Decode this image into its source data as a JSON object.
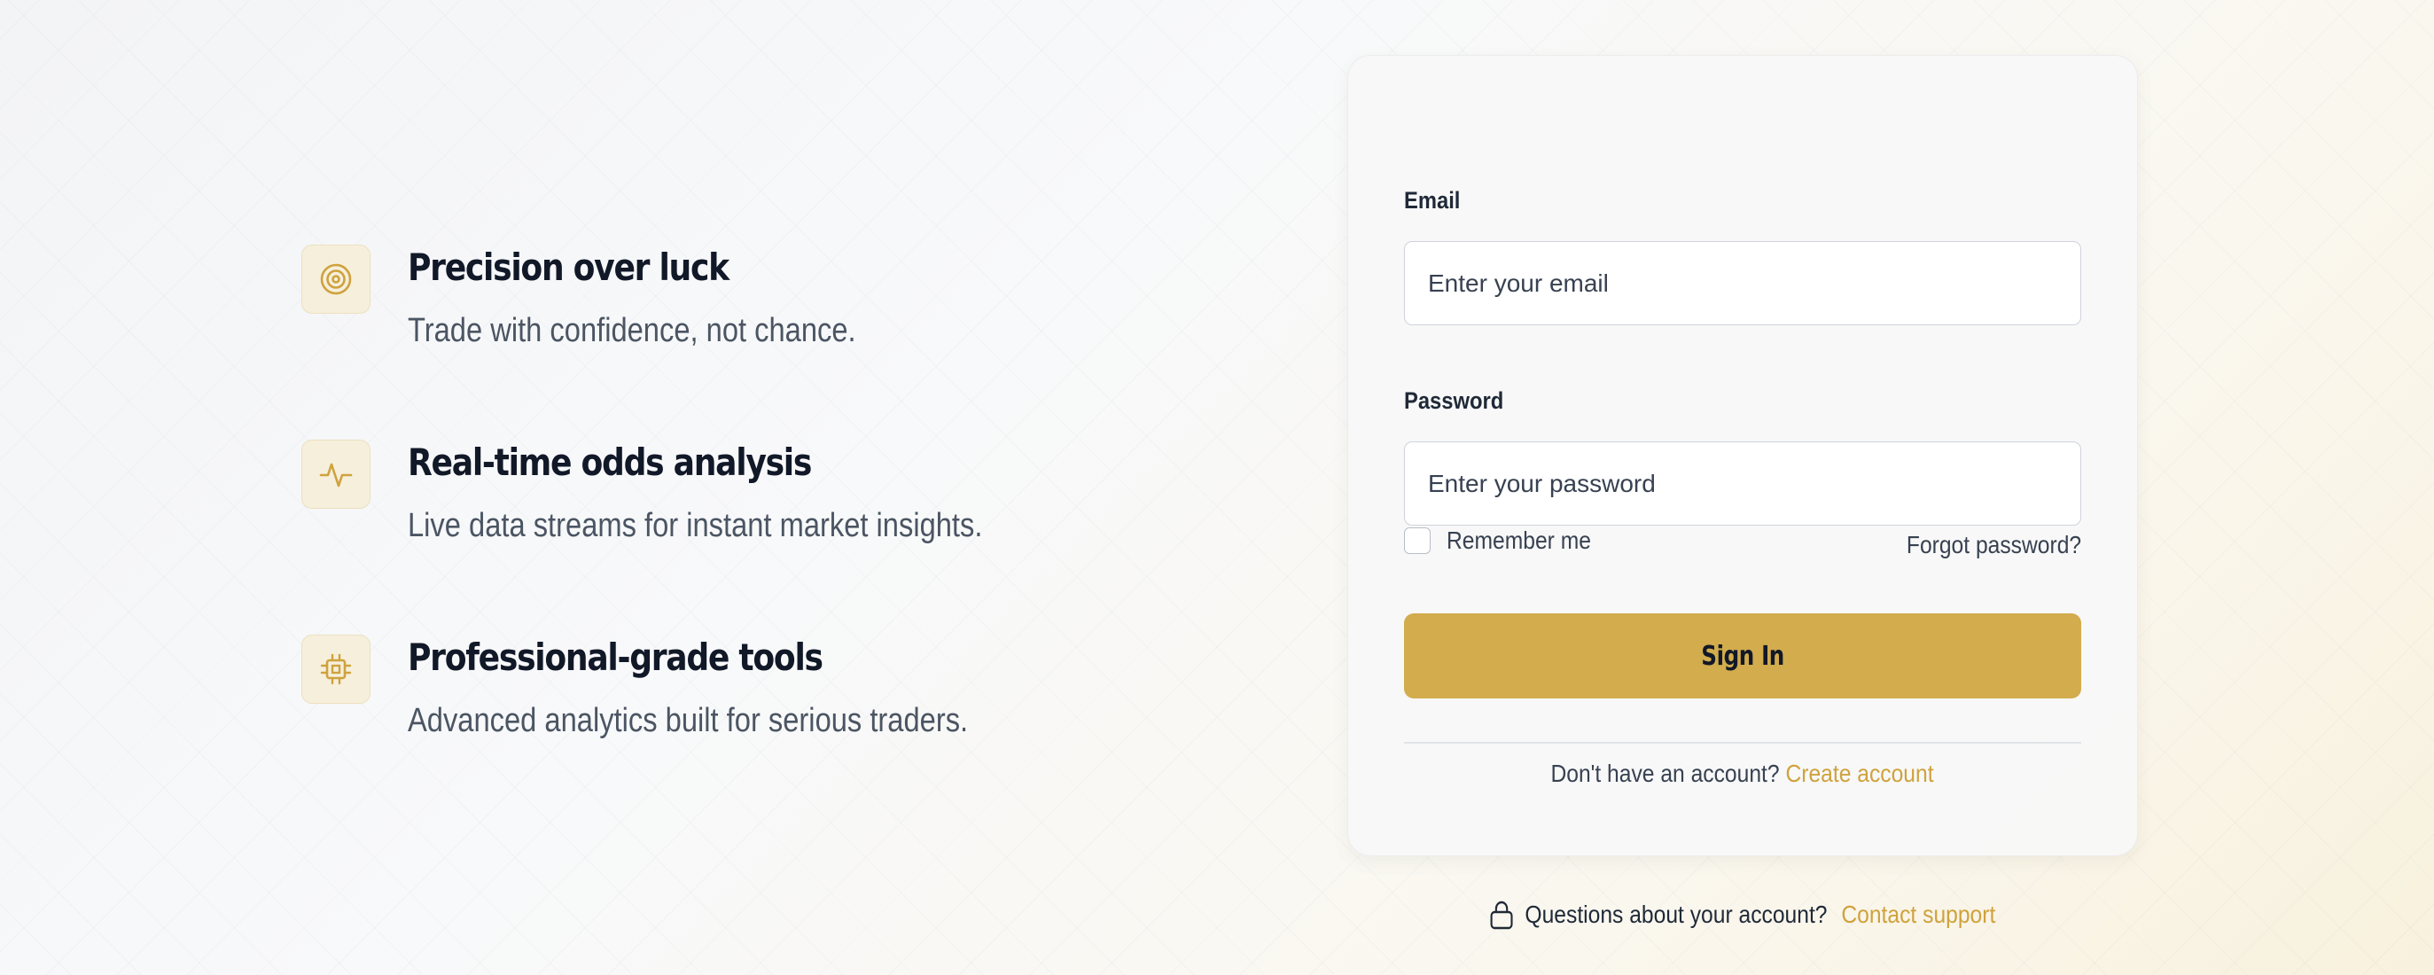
{
  "features": [
    {
      "icon": "target-icon",
      "title": "Precision over luck",
      "description": "Trade with confidence, not chance."
    },
    {
      "icon": "activity-pulse-icon",
      "title": "Real-time odds analysis",
      "description": "Live data streams for instant market insights."
    },
    {
      "icon": "cpu-chip-icon",
      "title": "Professional-grade tools",
      "description": "Advanced analytics built for serious traders."
    }
  ],
  "login": {
    "email_label": "Email",
    "email_placeholder": "Enter your email",
    "email_value": "",
    "password_label": "Password",
    "password_placeholder": "Enter your password",
    "password_value": "",
    "remember_label": "Remember me",
    "remember_checked": false,
    "forgot_label": "Forgot password?",
    "signin_label": "Sign In",
    "no_account_text": "Don't have an account?",
    "create_account_label": "Create account"
  },
  "support": {
    "icon": "lock-icon",
    "question": "Questions about your account?",
    "contact_label": "Contact support"
  },
  "colors": {
    "accent": "#d2ac4d",
    "accent_link": "#cfa23d",
    "icon_tile_bg": "#f6efdc",
    "heading": "#111827",
    "body_text": "#4b5563"
  }
}
